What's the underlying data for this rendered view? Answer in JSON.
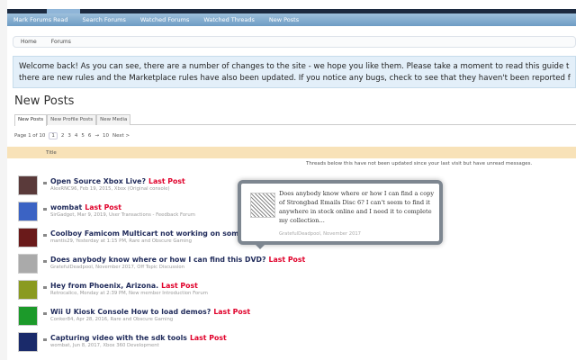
{
  "nav": [
    "Mark Forums Read",
    "Search Forums",
    "Watched Forums",
    "Watched Threads",
    "New Posts"
  ],
  "breadcrumb": [
    "Home",
    "Forums"
  ],
  "notice": [
    "Welcome back! As you can see, there are a number of changes to the site - we hope you like them. Please take a moment to read this guide t",
    "there are new rules and the Marketplace rules have also been updated. If you notice any bugs, check to see that they haven't been reported f"
  ],
  "title": "New Posts",
  "tabs": [
    "New Posts",
    "New Profile Posts",
    "New Media"
  ],
  "pager": {
    "label": "Page 1 of 10",
    "pages": [
      "1",
      "2",
      "3",
      "4",
      "5",
      "6",
      "→",
      "10",
      "Next >"
    ]
  },
  "table": {
    "header": "Title",
    "info": "Threads below this have not been updated since your last visit but have unread messages."
  },
  "colors": {
    "accent": "#e0002a",
    "header": "#f8e2b8",
    "notice": "#e3eff9"
  },
  "threads": [
    {
      "title": "Open Source Xbox Live?",
      "last": "Last Post",
      "meta": "AlexRNC96, Feb 19, 2015, Xbox (Original console)",
      "color": "#5a3a3a"
    },
    {
      "title": "wombat",
      "last": "Last Post",
      "meta": "SirGadget, Mar 9, 2019, User Transactions - Feedback Forum",
      "color": "#3b63c4"
    },
    {
      "title": "Coolboy Famicom Multicart not working on some Famicom",
      "last": "",
      "meta": "mantis29, Yesterday at 1:15 PM, Rare and Obscure Gaming",
      "color": "#6a1a1a"
    },
    {
      "title": "Does anybody know where or how I can find this DVD?",
      "last": "Last Post",
      "meta": "GratefulDeadpool, November 2017, Off Topic Discussion",
      "color": "#aaa"
    },
    {
      "title": "Hey from Phoenix, Arizona.",
      "last": "Last Post",
      "meta": "Retrocalico, Monday at 2:39 PM, New member Introduction Forum",
      "color": "#8a9a20"
    },
    {
      "title": "Wii U Kiosk Console How to load demos?",
      "last": "Last Post",
      "meta": "Conker84, Apr 28, 2016, Rare and Obscure Gaming",
      "color": "#1c9a2a"
    },
    {
      "title": "Capturing video with the sdk tools",
      "last": "Last Post",
      "meta": "wombat, Jun 8, 2017, Xbox 360 Development",
      "color": "#1a2a6a"
    }
  ],
  "tooltip": {
    "text": "Does anybody know where or how I can find a copy of Strongbad Emails Disc 6? I can't seem to find it anywhere in stock online and I need it to complete my collection...",
    "meta": "GratefulDeadpool, November 2017"
  }
}
